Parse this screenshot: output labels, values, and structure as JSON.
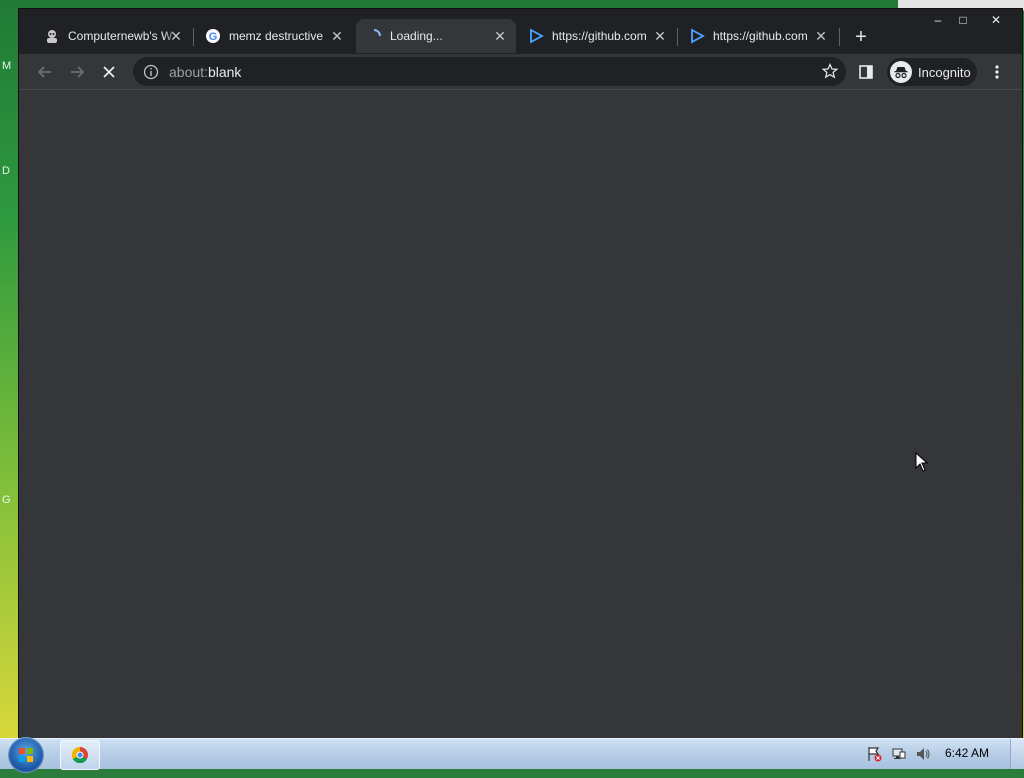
{
  "desktop": {
    "side_letters": [
      "M",
      "D",
      "G"
    ]
  },
  "browser": {
    "tabs": [
      {
        "title": "Computernewb's W",
        "icon": "cat-user-icon",
        "active": false
      },
      {
        "title": "memz destructive",
        "icon": "google-icon",
        "active": false
      },
      {
        "title": "Loading...",
        "icon": "spinner-icon",
        "active": true
      },
      {
        "title": "https://github.com",
        "icon": "play-triangle-icon",
        "active": false
      },
      {
        "title": "https://github.com",
        "icon": "play-triangle-icon",
        "active": false
      }
    ],
    "window_controls": {
      "minimize": "–",
      "maximize": "□",
      "close": "✕"
    },
    "new_tab_label": "+",
    "address": {
      "scheme": "about:",
      "path": "blank"
    },
    "profile_label": "Incognito",
    "colors": {
      "frame": "#202124",
      "toolbar": "#35363a",
      "content": "#35363a"
    }
  },
  "taskbar": {
    "clock": "6:42 AM",
    "pinned": [
      "chrome-icon"
    ],
    "tray": [
      "action-center-flag-icon",
      "network-icon",
      "volume-icon"
    ]
  }
}
